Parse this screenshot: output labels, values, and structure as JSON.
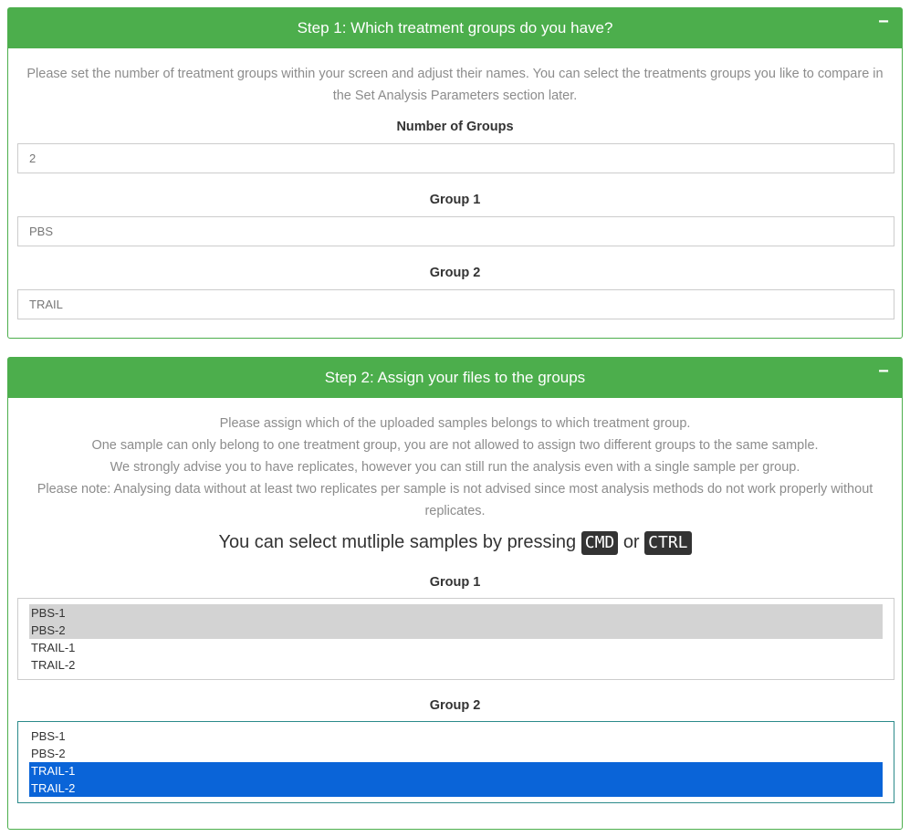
{
  "step1": {
    "title": "Step 1: Which treatment groups do you have?",
    "collapse_label": "−",
    "description_line1": "Please set the number of treatment groups within your screen and adjust their names. You can select the treatments groups you like to compare in",
    "description_line2": "the Set Analysis Parameters section later.",
    "number_of_groups_label": "Number of Groups",
    "number_of_groups_value": "2",
    "group1_label": "Group 1",
    "group1_value": "PBS",
    "group2_label": "Group 2",
    "group2_value": "TRAIL"
  },
  "step2": {
    "title": "Step 2: Assign your files to the groups",
    "collapse_label": "−",
    "desc_line1": "Please assign which of the uploaded samples belongs to which treatment group.",
    "desc_line2": "One sample can only belong to one treatment group, you are not allowed to assign two different groups to the same sample.",
    "desc_line3": "We strongly advise you to have replicates, however you can still run the analysis even with a single sample per group.",
    "desc_line4": "Please note: Analysing data without at least two replicates per sample is not advised since most analysis methods do not work properly without",
    "desc_line5": "replicates.",
    "hint_prefix": "You can select mutliple samples by pressing",
    "hint_key1": "CMD",
    "hint_or": "or",
    "hint_key2": "CTRL",
    "group1_label": "Group 1",
    "group1_options": [
      "PBS-1",
      "PBS-2",
      "TRAIL-1",
      "TRAIL-2"
    ],
    "group2_label": "Group 2",
    "group2_options": [
      "PBS-1",
      "PBS-2",
      "TRAIL-1",
      "TRAIL-2"
    ]
  },
  "colors": {
    "panel_green": "#4cae4c",
    "selected_gray": "#d3d3d3",
    "selected_blue": "#0a64d8"
  }
}
